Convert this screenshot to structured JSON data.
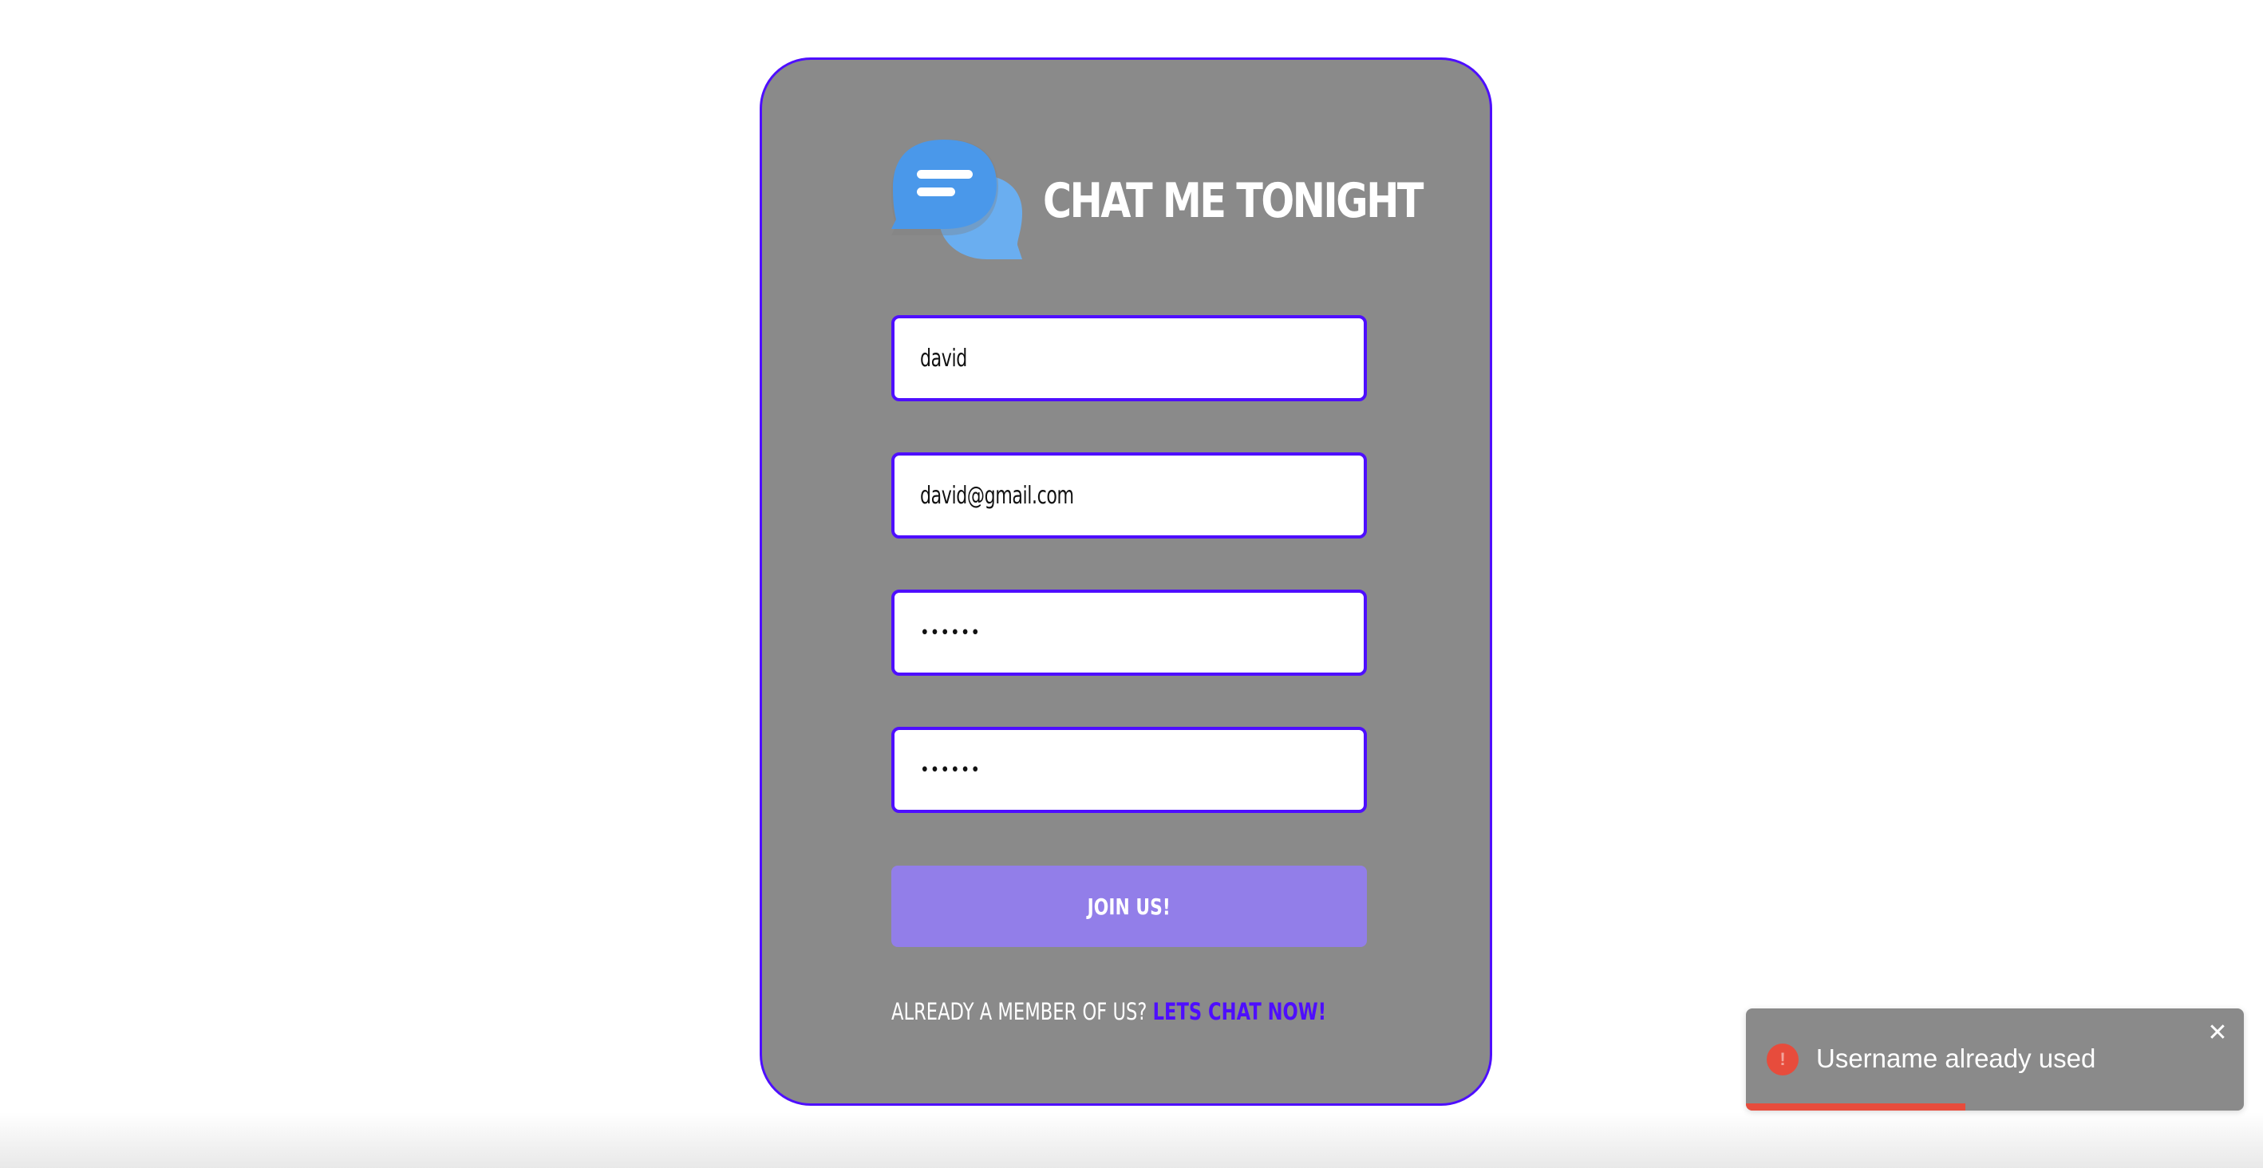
{
  "brand": {
    "title": "CHAT ME TONIGHT",
    "logo_icon": "chat-bubbles-icon",
    "colors": {
      "bubble_front": "#4a98ea",
      "bubble_back": "#6aaef0"
    }
  },
  "form": {
    "username": {
      "value": "david"
    },
    "email": {
      "value": "david@gmail.com"
    },
    "password": {
      "value": "••••••"
    },
    "confirm_password": {
      "value": "••••••"
    },
    "submit_label": "JOIN US!",
    "footer_text": "ALREADY A MEMBER OF US? ",
    "footer_link": "LETS CHAT NOW!"
  },
  "toast": {
    "message": "Username already used",
    "icon": "error-icon",
    "icon_glyph": "!",
    "close_glyph": "✕",
    "close_icon": "close-icon",
    "progress_fraction": 0.44
  },
  "colors": {
    "accent": "#4e0eff",
    "card_bg": "#8a8a8a",
    "button_bg": "#927ee9",
    "error": "#e74c3c"
  }
}
